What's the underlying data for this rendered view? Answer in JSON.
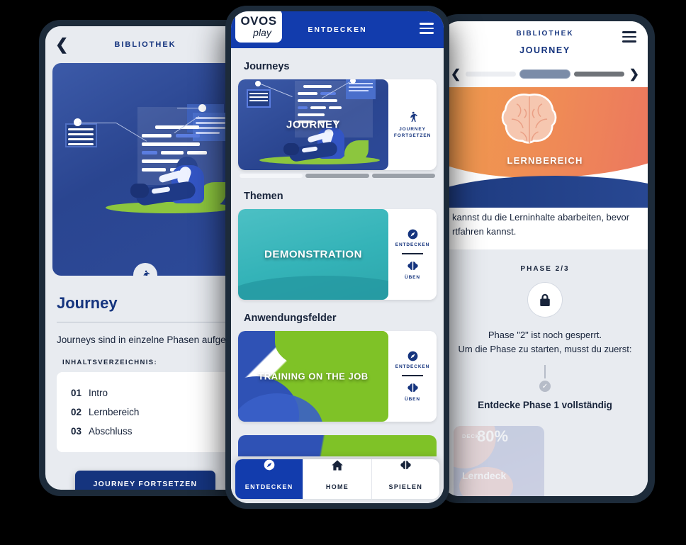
{
  "theme": {
    "brand_blue": "#123cad",
    "deep_navy": "#15347e",
    "dark_ink": "#17233a",
    "screen_bg": "#e8ebf0",
    "frame": "#1d2b3a",
    "teal": "#34b3b8",
    "green": "#7fc227",
    "orange": "#ef8a4a"
  },
  "left_phone": {
    "header": {
      "back_icon": "chevron-left-icon",
      "title": "BIBLIOTHEK"
    },
    "hero": {
      "badge_icon": "hiker-icon"
    },
    "title": "Journey",
    "paragraph": "Journeys sind in einzelne Phasen aufgebaut",
    "toc_label": "INHALTSVERZEICHNIS:",
    "toc": [
      {
        "num": "01",
        "label": "Intro"
      },
      {
        "num": "02",
        "label": "Lernbereich"
      },
      {
        "num": "03",
        "label": "Abschluss"
      }
    ],
    "cta": "JOURNEY FORTSETZEN"
  },
  "center_phone": {
    "header": {
      "logo_line1": "OVOS",
      "logo_line2": "play",
      "title": "ENTDECKEN",
      "menu_icon": "hamburger-menu-icon"
    },
    "sections": [
      {
        "title": "Journeys",
        "card": {
          "thumb_label": "JOURNEY",
          "actions": [
            {
              "icon": "hiker-icon",
              "label": "JOURNEY\nFORTSETZEN"
            }
          ],
          "pager": [
            "done",
            "current",
            "upcoming"
          ]
        }
      },
      {
        "title": "Themen",
        "card": {
          "thumb_label": "DEMONSTRATION",
          "actions": [
            {
              "icon": "compass-icon",
              "label": "ENTDECKEN"
            },
            {
              "icon": "brain-icon",
              "label": "ÜBEN"
            }
          ]
        }
      },
      {
        "title": "Anwendungsfelder",
        "card": {
          "thumb_label": "TRAINING ON THE JOB",
          "actions": [
            {
              "icon": "compass-icon",
              "label": "ENTDECKEN"
            },
            {
              "icon": "brain-icon",
              "label": "ÜBEN"
            }
          ]
        }
      }
    ],
    "bottom_nav": [
      {
        "icon": "compass-icon",
        "label": "ENTDECKEN",
        "active": true
      },
      {
        "icon": "home-icon",
        "label": "HOME",
        "active": false
      },
      {
        "icon": "brain-icon",
        "label": "SPIELEN",
        "active": false
      }
    ]
  },
  "right_phone": {
    "header": {
      "breadcrumb": "BIBLIOTHEK",
      "title": "JOURNEY",
      "menu_icon": "hamburger-menu-icon",
      "prev_icon": "chevron-left-icon",
      "next_icon": "chevron-right-icon"
    },
    "hero": {
      "label": "LERNBEREICH",
      "icon": "brain-illustration"
    },
    "description_line1": "kannst du die Lerninhalte abarbeiten, bevor",
    "description_line2": "rtfahren kannst.",
    "phase_counter": "PHASE 2/3",
    "lock_icon": "padlock-icon",
    "lock_line1": "Phase \"2\" ist noch gesperrt.",
    "lock_line2": "Um die Phase zu starten, musst du zuerst:",
    "check_icon": "check-circle-icon",
    "goal": "Entdecke Phase 1 vollständig",
    "deck": {
      "kicker": "DECK",
      "percent": "80%",
      "name": "Lerndeck"
    }
  }
}
